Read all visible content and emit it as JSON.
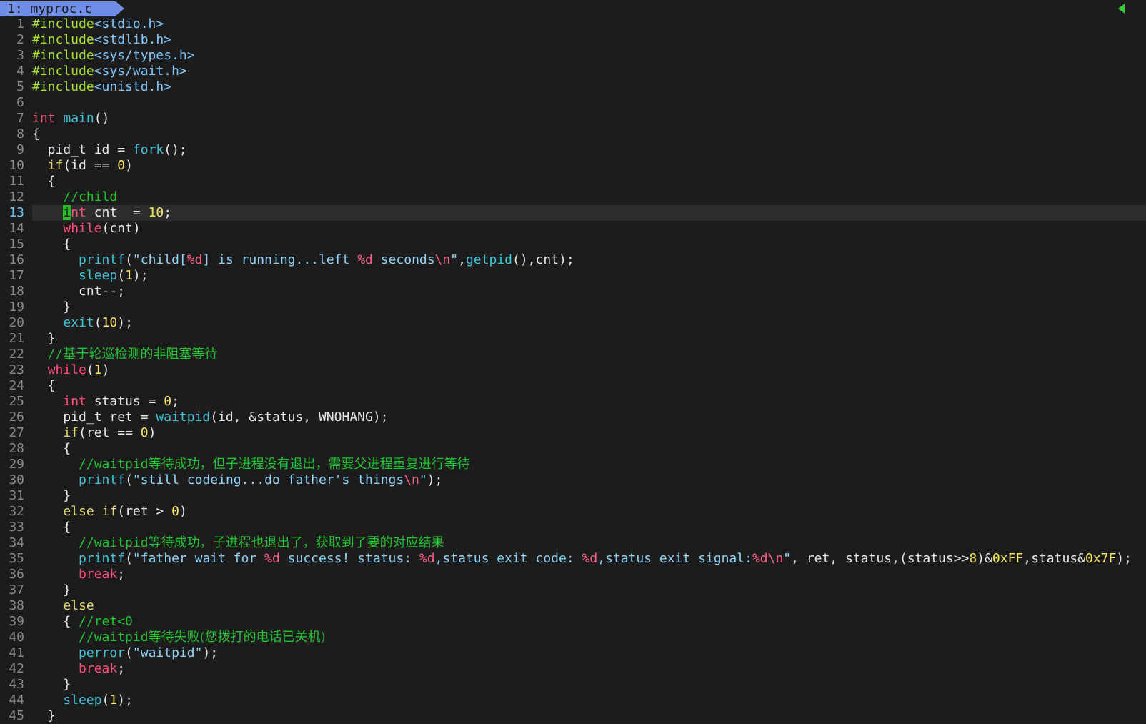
{
  "tab": {
    "label": "1: myproc.c"
  },
  "colors": {
    "background": "#1c1c1c",
    "tab": "#6f8ee8",
    "line_number": "#8a8a8a",
    "current_line_number": "#66ccff",
    "cursor": "#22c022",
    "comment": "#22c232",
    "keyword": "#ff4f7a",
    "function": "#3ec5d8",
    "number": "#f5e663"
  },
  "cursor": {
    "line": 13,
    "column": 5
  },
  "lines": [
    {
      "n": "1",
      "tokens": [
        [
          "pre",
          "#include"
        ],
        [
          "inc",
          "<stdio.h>"
        ]
      ]
    },
    {
      "n": "2",
      "tokens": [
        [
          "pre",
          "#include"
        ],
        [
          "inc",
          "<stdlib.h>"
        ]
      ]
    },
    {
      "n": "3",
      "tokens": [
        [
          "pre",
          "#include"
        ],
        [
          "inc",
          "<sys/types.h>"
        ]
      ]
    },
    {
      "n": "4",
      "tokens": [
        [
          "pre",
          "#include"
        ],
        [
          "inc",
          "<sys/wait.h>"
        ]
      ]
    },
    {
      "n": "5",
      "tokens": [
        [
          "pre",
          "#include"
        ],
        [
          "inc",
          "<unistd.h>"
        ]
      ]
    },
    {
      "n": "6",
      "tokens": []
    },
    {
      "n": "7",
      "tokens": [
        [
          "kw",
          "int"
        ],
        [
          "txt",
          " "
        ],
        [
          "fn",
          "main"
        ],
        [
          "txt",
          "()"
        ]
      ]
    },
    {
      "n": "8",
      "tokens": [
        [
          "txt",
          "{"
        ]
      ]
    },
    {
      "n": "9",
      "tokens": [
        [
          "txt",
          "  pid_t id = "
        ],
        [
          "fn",
          "fork"
        ],
        [
          "txt",
          "();"
        ]
      ]
    },
    {
      "n": "10",
      "tokens": [
        [
          "txt",
          "  "
        ],
        [
          "ctl",
          "if"
        ],
        [
          "txt",
          "(id == "
        ],
        [
          "num",
          "0"
        ],
        [
          "txt",
          ")"
        ]
      ]
    },
    {
      "n": "11",
      "tokens": [
        [
          "txt",
          "  {"
        ]
      ]
    },
    {
      "n": "12",
      "tokens": [
        [
          "txt",
          "    "
        ],
        [
          "com",
          "//child"
        ]
      ]
    },
    {
      "n": "13",
      "current": true,
      "tokens": [
        [
          "txt",
          "    "
        ],
        [
          "cursor",
          "i"
        ],
        [
          "kw",
          "nt"
        ],
        [
          "txt",
          " cnt  = "
        ],
        [
          "num",
          "10"
        ],
        [
          "txt",
          ";"
        ]
      ]
    },
    {
      "n": "14",
      "tokens": [
        [
          "txt",
          "    "
        ],
        [
          "kw",
          "while"
        ],
        [
          "txt",
          "(cnt)"
        ]
      ]
    },
    {
      "n": "15",
      "tokens": [
        [
          "txt",
          "    {"
        ]
      ]
    },
    {
      "n": "16",
      "tokens": [
        [
          "txt",
          "      "
        ],
        [
          "fn",
          "printf"
        ],
        [
          "txt",
          "("
        ],
        [
          "str",
          "\"child["
        ],
        [
          "fmt",
          "%d"
        ],
        [
          "str",
          "] is running...left "
        ],
        [
          "fmt",
          "%d"
        ],
        [
          "str",
          " seconds"
        ],
        [
          "fmt",
          "\\n"
        ],
        [
          "str",
          "\""
        ],
        [
          "txt",
          ","
        ],
        [
          "fn",
          "getpid"
        ],
        [
          "txt",
          "(),cnt);"
        ]
      ]
    },
    {
      "n": "17",
      "tokens": [
        [
          "txt",
          "      "
        ],
        [
          "fn",
          "sleep"
        ],
        [
          "txt",
          "("
        ],
        [
          "num",
          "1"
        ],
        [
          "txt",
          ");"
        ]
      ]
    },
    {
      "n": "18",
      "tokens": [
        [
          "txt",
          "      cnt--;"
        ]
      ]
    },
    {
      "n": "19",
      "tokens": [
        [
          "txt",
          "    }"
        ]
      ]
    },
    {
      "n": "20",
      "tokens": [
        [
          "txt",
          "    "
        ],
        [
          "fn",
          "exit"
        ],
        [
          "txt",
          "("
        ],
        [
          "num",
          "10"
        ],
        [
          "txt",
          ");"
        ]
      ]
    },
    {
      "n": "21",
      "tokens": [
        [
          "txt",
          "  }"
        ]
      ]
    },
    {
      "n": "22",
      "tokens": [
        [
          "txt",
          "  "
        ],
        [
          "com",
          "//"
        ],
        [
          "cjk",
          "基于轮巡检测的非阻塞等待"
        ]
      ]
    },
    {
      "n": "23",
      "tokens": [
        [
          "txt",
          "  "
        ],
        [
          "kw",
          "while"
        ],
        [
          "txt",
          "("
        ],
        [
          "num",
          "1"
        ],
        [
          "txt",
          ")"
        ]
      ]
    },
    {
      "n": "24",
      "tokens": [
        [
          "txt",
          "  {"
        ]
      ]
    },
    {
      "n": "25",
      "tokens": [
        [
          "txt",
          "    "
        ],
        [
          "kw",
          "int"
        ],
        [
          "txt",
          " status = "
        ],
        [
          "num",
          "0"
        ],
        [
          "txt",
          ";"
        ]
      ]
    },
    {
      "n": "26",
      "tokens": [
        [
          "txt",
          "    pid_t ret = "
        ],
        [
          "fn",
          "waitpid"
        ],
        [
          "txt",
          "(id, &status, WNOHANG);"
        ]
      ]
    },
    {
      "n": "27",
      "tokens": [
        [
          "txt",
          "    "
        ],
        [
          "ctl",
          "if"
        ],
        [
          "txt",
          "(ret == "
        ],
        [
          "num",
          "0"
        ],
        [
          "txt",
          ")"
        ]
      ]
    },
    {
      "n": "28",
      "tokens": [
        [
          "txt",
          "    {"
        ]
      ]
    },
    {
      "n": "29",
      "tokens": [
        [
          "txt",
          "      "
        ],
        [
          "com",
          "//waitpid"
        ],
        [
          "cjk",
          "等待成功，但子进程没有退出，需要父进程重复进行等待"
        ]
      ]
    },
    {
      "n": "30",
      "tokens": [
        [
          "txt",
          "      "
        ],
        [
          "fn",
          "printf"
        ],
        [
          "txt",
          "("
        ],
        [
          "str",
          "\"still codeing...do father's things"
        ],
        [
          "fmt",
          "\\n"
        ],
        [
          "str",
          "\""
        ],
        [
          "txt",
          ");"
        ]
      ]
    },
    {
      "n": "31",
      "tokens": [
        [
          "txt",
          "    }"
        ]
      ]
    },
    {
      "n": "32",
      "tokens": [
        [
          "txt",
          "    "
        ],
        [
          "ctl",
          "else"
        ],
        [
          "txt",
          " "
        ],
        [
          "ctl",
          "if"
        ],
        [
          "txt",
          "(ret > "
        ],
        [
          "num",
          "0"
        ],
        [
          "txt",
          ")"
        ]
      ]
    },
    {
      "n": "33",
      "tokens": [
        [
          "txt",
          "    {"
        ]
      ]
    },
    {
      "n": "34",
      "tokens": [
        [
          "txt",
          "      "
        ],
        [
          "com",
          "//waitpid"
        ],
        [
          "cjk",
          "等待成功，子进程也退出了，获取到了要的对应结果"
        ]
      ]
    },
    {
      "n": "35",
      "tokens": [
        [
          "txt",
          "      "
        ],
        [
          "fn",
          "printf"
        ],
        [
          "txt",
          "("
        ],
        [
          "str",
          "\"father wait for "
        ],
        [
          "fmt",
          "%d"
        ],
        [
          "str",
          " success! status: "
        ],
        [
          "fmt",
          "%d"
        ],
        [
          "str",
          ",status exit code: "
        ],
        [
          "fmt",
          "%d"
        ],
        [
          "str",
          ",status exit signal:"
        ],
        [
          "fmt",
          "%d\\n"
        ],
        [
          "str",
          "\""
        ],
        [
          "txt",
          ", ret, status,(status>>"
        ],
        [
          "num",
          "8"
        ],
        [
          "txt",
          ")&"
        ],
        [
          "num",
          "0xFF"
        ],
        [
          "txt",
          ",status&"
        ],
        [
          "num",
          "0x7F"
        ],
        [
          "txt",
          ");"
        ]
      ]
    },
    {
      "n": "36",
      "tokens": [
        [
          "txt",
          "      "
        ],
        [
          "kw",
          "break"
        ],
        [
          "txt",
          ";"
        ]
      ]
    },
    {
      "n": "37",
      "tokens": [
        [
          "txt",
          "    }"
        ]
      ]
    },
    {
      "n": "38",
      "tokens": [
        [
          "txt",
          "    "
        ],
        [
          "ctl",
          "else"
        ]
      ]
    },
    {
      "n": "39",
      "tokens": [
        [
          "txt",
          "    { "
        ],
        [
          "com",
          "//ret<0"
        ]
      ]
    },
    {
      "n": "40",
      "tokens": [
        [
          "txt",
          "      "
        ],
        [
          "com",
          "//waitpid"
        ],
        [
          "cjk",
          "等待失败(您拨打的电话已关机)"
        ]
      ]
    },
    {
      "n": "41",
      "tokens": [
        [
          "txt",
          "      "
        ],
        [
          "fn",
          "perror"
        ],
        [
          "txt",
          "("
        ],
        [
          "str",
          "\"waitpid\""
        ],
        [
          "txt",
          ");"
        ]
      ]
    },
    {
      "n": "42",
      "tokens": [
        [
          "txt",
          "      "
        ],
        [
          "kw",
          "break"
        ],
        [
          "txt",
          ";"
        ]
      ]
    },
    {
      "n": "43",
      "tokens": [
        [
          "txt",
          "    }"
        ]
      ]
    },
    {
      "n": "44",
      "tokens": [
        [
          "txt",
          "    "
        ],
        [
          "fn",
          "sleep"
        ],
        [
          "txt",
          "("
        ],
        [
          "num",
          "1"
        ],
        [
          "txt",
          ");"
        ]
      ]
    },
    {
      "n": "45",
      "tokens": [
        [
          "txt",
          "  }"
        ]
      ]
    }
  ]
}
